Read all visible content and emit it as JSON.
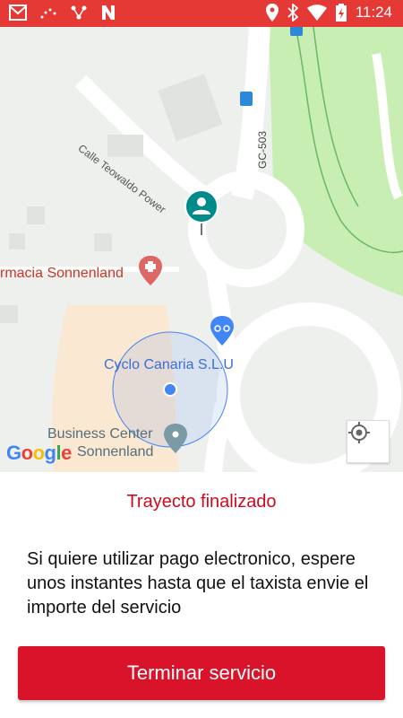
{
  "status_bar": {
    "time": "11:24",
    "icons": [
      "gmail-icon",
      "dots-icon",
      "share-icon",
      "n-icon",
      "location-icon",
      "bluetooth-icon",
      "wifi-icon",
      "battery-charging-icon"
    ]
  },
  "map": {
    "labels": {
      "street": "Calle Teowaldo Power",
      "road": "GC-503",
      "pharmacy": "rmacia Sonnenland",
      "bike_shop": "Cyclo Canaria S.L.U",
      "business_line1": "Business Center",
      "business_line2": "Sonnenland"
    },
    "google_letters": [
      "G",
      "o",
      "o",
      "g",
      "l",
      "e"
    ],
    "colors": {
      "road": "#ffffff",
      "park": "#c9eeb4",
      "accuracy_circle": "#4285f4",
      "marker_teal": "#008b8b"
    }
  },
  "trip": {
    "status": "Trayecto finalizado",
    "message": "Si quiere utilizar pago electronico, espere unos instantes hasta que el taxista envie el importe del servicio",
    "finish_button": "Terminar servicio"
  },
  "colors": {
    "brand_red": "#d9142a",
    "status_bar": "#e53935"
  }
}
